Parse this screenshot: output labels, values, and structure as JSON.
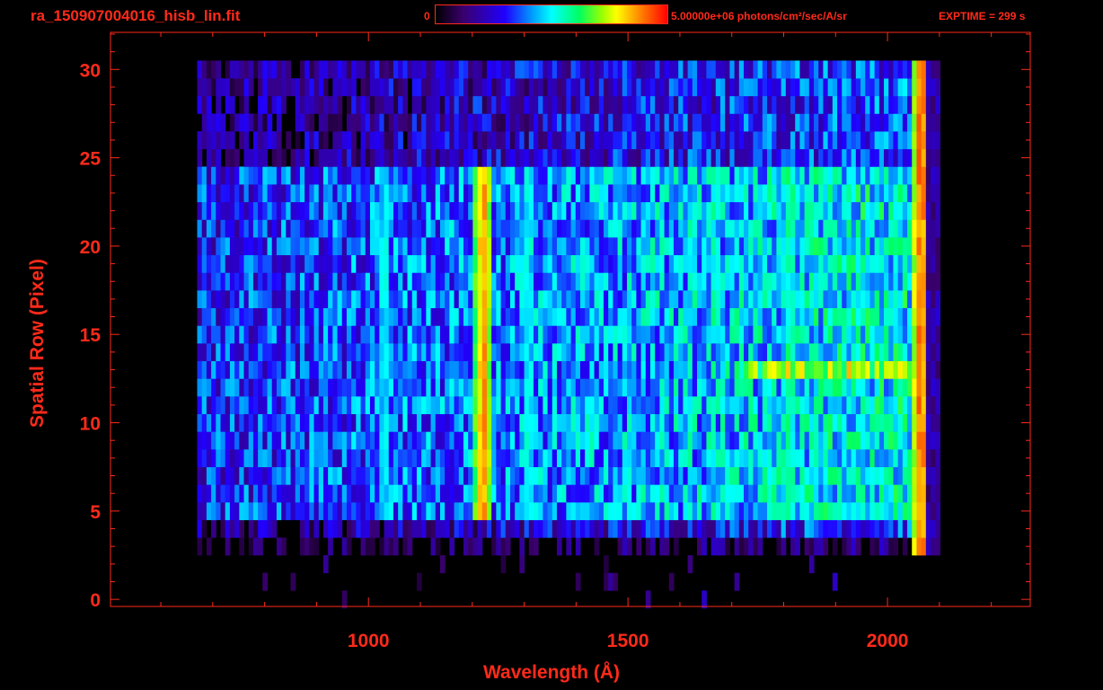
{
  "header": {
    "title": "ra_150907004016_hisb_lin.fit",
    "colorbar_min": "0",
    "colorbar_max_label": "5.00000e+06 photons/cm²/sec/A/sr",
    "exptime": "EXPTIME = 299 s"
  },
  "chart_data": {
    "type": "heatmap",
    "title": "ra_150907004016_hisb_lin.fit",
    "xlabel": "Wavelength (Å)",
    "ylabel": "Spatial Row (Pixel)",
    "xlim": [
      503,
      2275
    ],
    "ylim": [
      -0.4,
      32.1
    ],
    "xticks": [
      1000,
      1500,
      2000
    ],
    "xtick_labels": [
      "1000",
      "1500",
      "2000"
    ],
    "yticks": [
      0,
      5,
      10,
      15,
      20,
      25,
      30
    ],
    "ytick_labels": [
      "0",
      "5",
      "10",
      "15",
      "20",
      "25",
      "30"
    ],
    "colormap": "rainbow",
    "zlim": [
      0,
      5000000
    ],
    "rows": [
      0,
      30
    ],
    "wavelength_range": [
      670,
      2100
    ],
    "bright_rows": [
      5,
      24
    ],
    "emission_lines": [
      {
        "wavelength": 1026,
        "strength": 0.55
      },
      {
        "wavelength": 1216,
        "strength": 0.9
      },
      {
        "wavelength": 1304,
        "strength": 0.55
      },
      {
        "wavelength": 1808,
        "strength": 0.6
      },
      {
        "wavelength": 2060,
        "strength": 0.95
      }
    ],
    "grid": false
  },
  "axis_color": "#ff2a1a"
}
